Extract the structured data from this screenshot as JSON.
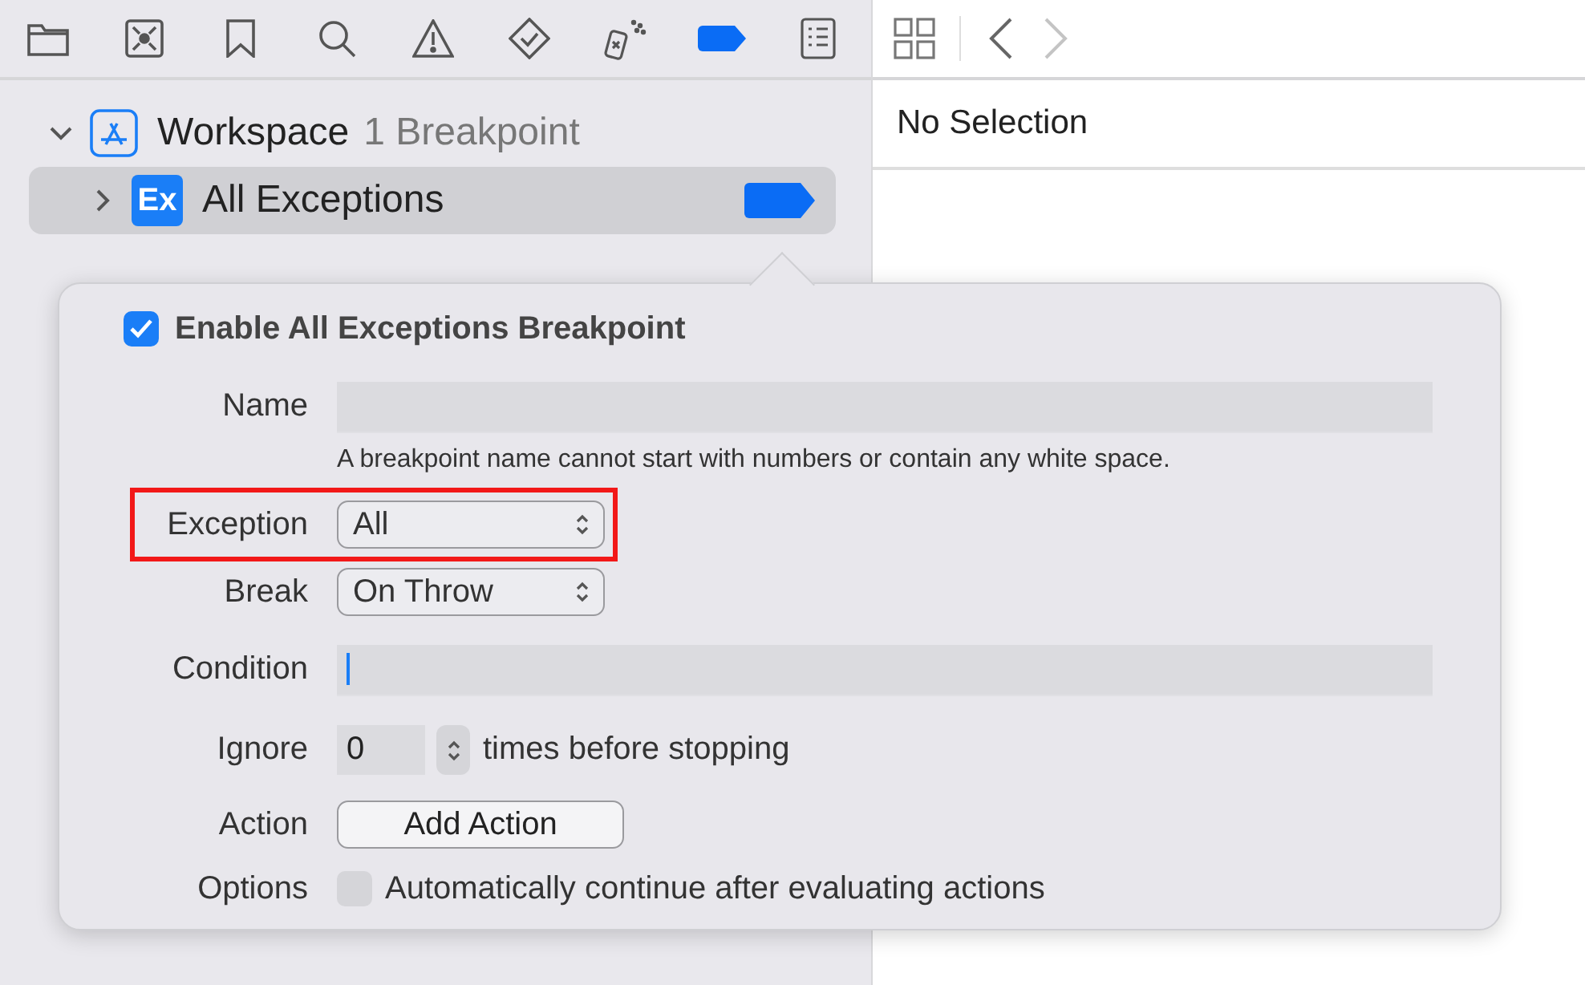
{
  "navigator_tabs": [
    {
      "selected": false
    },
    {
      "selected": false
    },
    {
      "selected": false
    },
    {
      "selected": false
    },
    {
      "selected": false
    },
    {
      "selected": false
    },
    {
      "selected": false
    },
    {
      "selected": true
    },
    {
      "selected": false
    }
  ],
  "tree": [
    {
      "label": "Workspace",
      "count": "1 Breakpoint",
      "expanded": true,
      "selected": false,
      "children": [
        {
          "badge": "Ex",
          "label": "All Exceptions",
          "expanded": false,
          "selected": true,
          "enabled": true
        }
      ]
    }
  ],
  "inspector": {
    "back_disabled": false,
    "forward_disabled": true,
    "title": "No Selection"
  },
  "popover": {
    "enable": {
      "label": "Enable All Exceptions Breakpoint",
      "checked": true
    },
    "name": {
      "label": "Name",
      "hint": "A breakpoint name cannot start with numbers or contain any white space."
    },
    "exception": {
      "label": "Exception",
      "value": "All",
      "highlighted": true
    },
    "break": {
      "label": "Break",
      "value": "On Throw",
      "highlighted": false
    },
    "condition": {
      "label": "Condition",
      "focused": true
    },
    "ignore": {
      "label": "Ignore",
      "value": "0",
      "suffix": "times before stopping"
    },
    "action": {
      "label": "Action",
      "button": "Add Action"
    },
    "options": {
      "label": "Options",
      "checked": false,
      "text": "Automatically continue after evaluating actions"
    }
  }
}
